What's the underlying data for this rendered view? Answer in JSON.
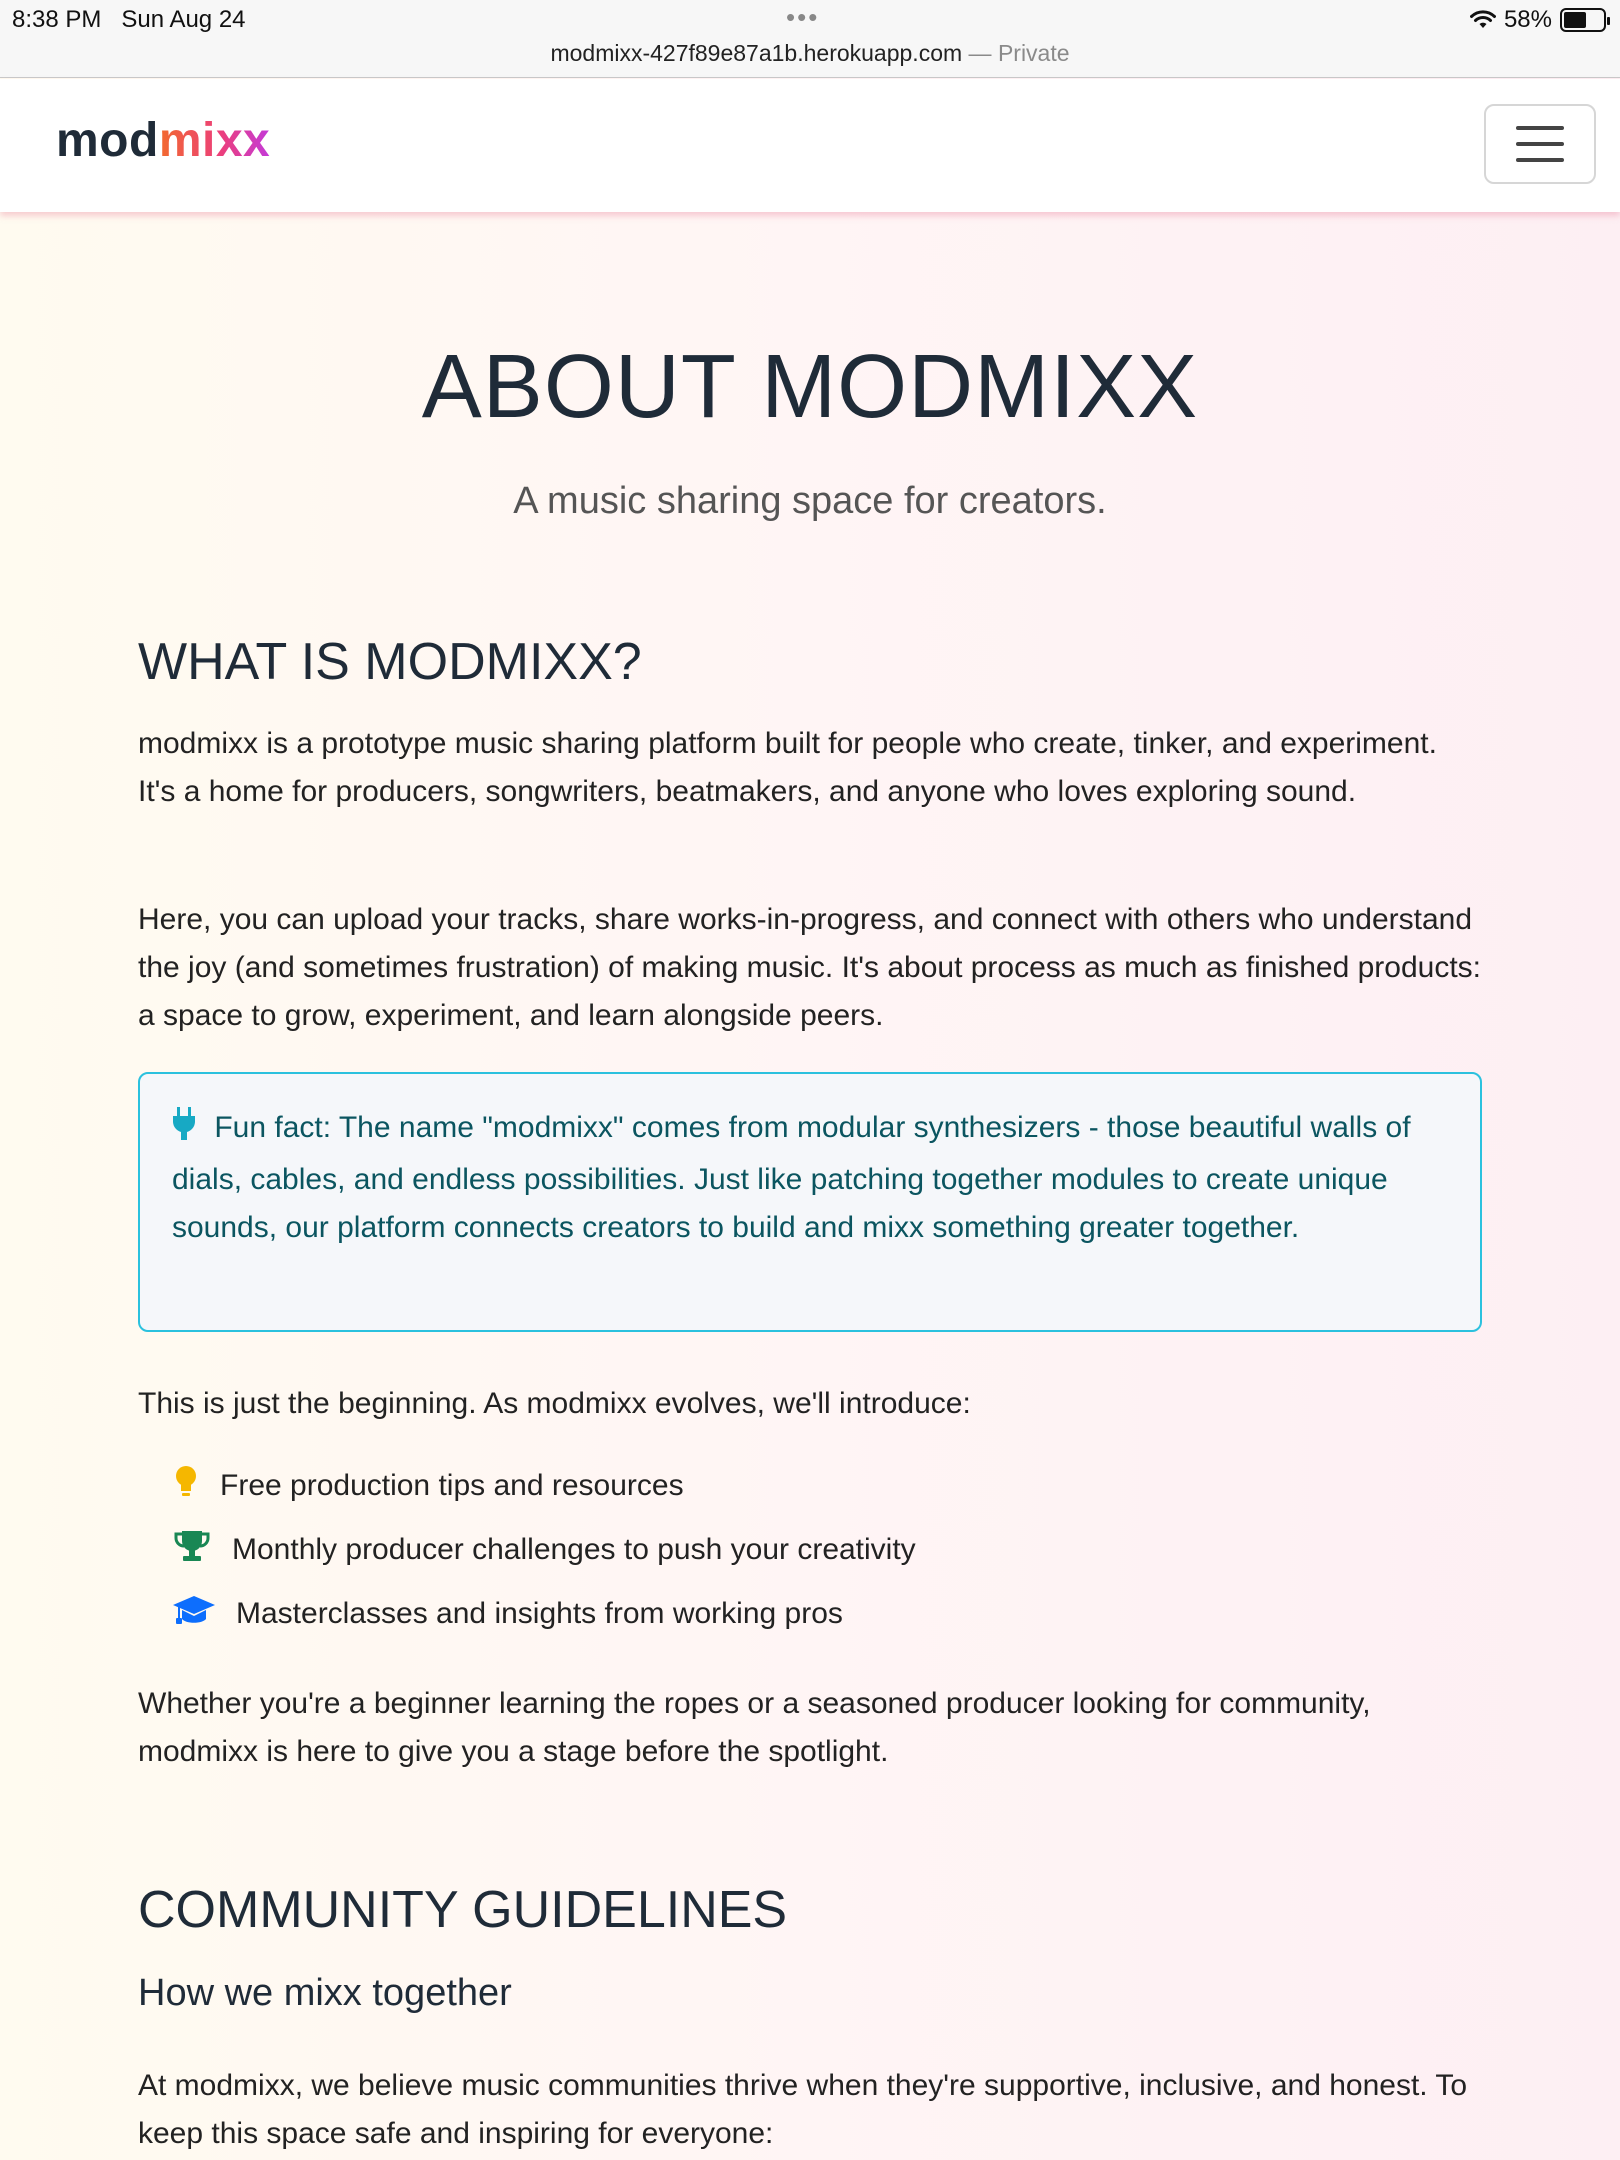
{
  "status_bar": {
    "time": "8:38 PM",
    "date": "Sun Aug 24",
    "dots": "•••",
    "battery": "58%",
    "battery_level": 0.58,
    "url": "modmixx-427f89e87a1b.herokuapp.com",
    "url_separator": " — ",
    "private_label": "Private"
  },
  "navbar": {
    "brand_part1": "mod",
    "brand_part2": "mixx",
    "menu_icon": "hamburger-menu-icon"
  },
  "page": {
    "title": "ABOUT MODMIXX",
    "subtitle": "A music sharing space for creators.",
    "section1_heading": "WHAT IS MODMIXX?",
    "section1_p1": "modmixx is a prototype music sharing platform built for people who create, tinker, and experiment. It's a home for producers, songwriters, beatmakers, and anyone who loves exploring sound.",
    "section1_p2": "Here, you can upload your tracks, share works-in-progress, and connect with others who understand the joy (and sometimes frustration) of making music. It's about process as much as finished products: a space to grow, experiment, and learn alongside peers.",
    "fun_fact": "Fun fact: The name \"modmixx\" comes from modular synthesizers - those beautiful walls of dials, cables, and endless possibilities. Just like patching together modules to create unique sounds, our platform connects creators to build and mixx something greater together.",
    "fun_fact_icon": "plug-icon",
    "intro_list": "This is just the beginning. As modmixx evolves, we'll introduce:",
    "features": [
      {
        "icon": "lightbulb-icon",
        "color": "#f5b700",
        "text": "Free production tips and resources"
      },
      {
        "icon": "trophy-icon",
        "color": "#198754",
        "text": "Monthly producer challenges to push your creativity"
      },
      {
        "icon": "graduation-cap-icon",
        "color": "#0d6efd",
        "text": "Masterclasses and insights from working pros"
      }
    ],
    "closing": "Whether you're a beginner learning the ropes or a seasoned producer looking for community, modmixx is here to give you a stage before the spotlight.",
    "section2_heading": "COMMUNITY GUIDELINES",
    "section2_subheading": "How we mixx together",
    "section2_p1": "At modmixx, we believe music communities thrive when they're supportive, inclusive, and honest. To keep this space safe and inspiring for everyone:"
  },
  "colors": {
    "accent_cyan": "#2bc1de",
    "heading": "#1f2b38",
    "brand_gradient_start": "#f26a2e",
    "brand_gradient_end": "#c43ad9"
  }
}
